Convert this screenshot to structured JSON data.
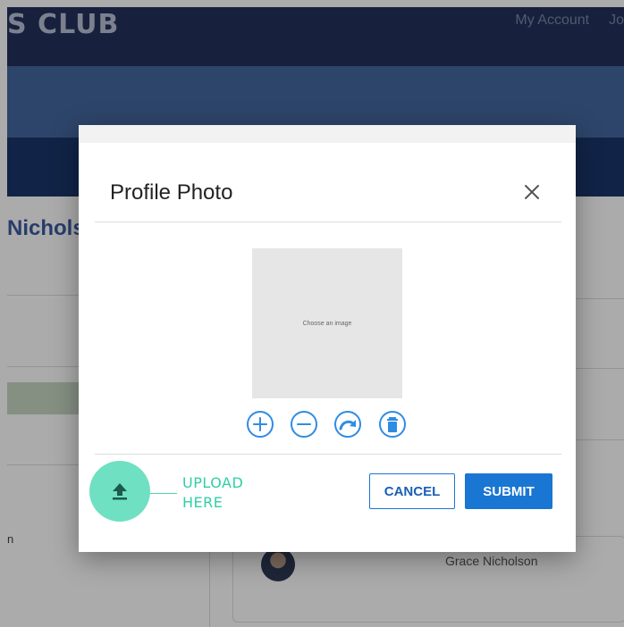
{
  "header": {
    "brand": "S CLUB",
    "nav": [
      "My Account",
      "Jo"
    ]
  },
  "background": {
    "profile_name": "Nichols",
    "side_text": "n",
    "member_name": "Grace Nicholson"
  },
  "modal": {
    "title": "Profile Photo",
    "image_placeholder": "Choose an image",
    "tools": [
      "zoom-in-icon",
      "zoom-out-icon",
      "rotate-icon",
      "delete-icon"
    ],
    "upload_hint": "UPLOAD\nHERE",
    "cancel_label": "CANCEL",
    "submit_label": "SUBMIT"
  },
  "colors": {
    "accent": "#1976d2",
    "upload": "#6fe0c2",
    "topbar": "#23305c"
  }
}
